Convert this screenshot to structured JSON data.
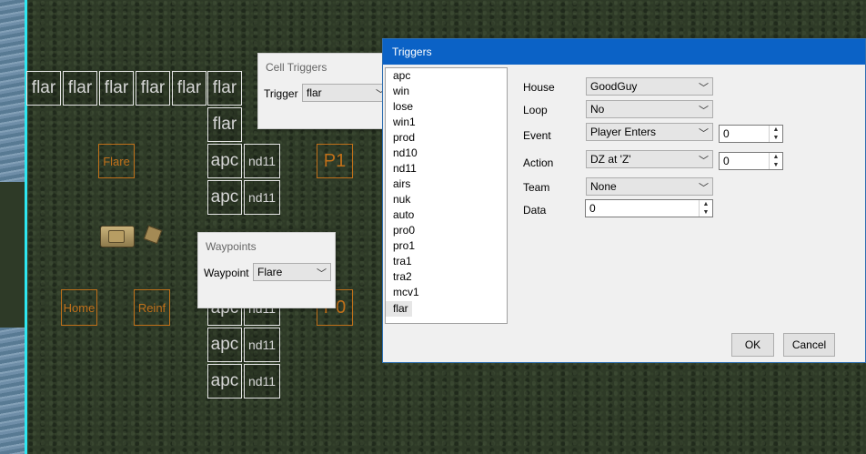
{
  "map": {
    "trigger_cells_top": [
      "flar",
      "flar",
      "flar",
      "flar",
      "flar",
      "flar"
    ],
    "trigger_cell_flar2": "flar",
    "apc_rows": [
      {
        "left": "apc",
        "right": "nd11"
      },
      {
        "left": "apc",
        "right": "nd11"
      },
      {
        "left": "apc",
        "right": "nd11"
      },
      {
        "left": "apc",
        "right": "nd11"
      },
      {
        "left": "apc",
        "right": "nd11"
      }
    ],
    "waypoints": {
      "flare": "Flare",
      "p1": "P1",
      "home": "Home",
      "reinf": "Reinf",
      "p0": "P0"
    }
  },
  "cell_triggers": {
    "title": "Cell Triggers",
    "trigger_label": "Trigger",
    "trigger_value": "flar"
  },
  "waypoints_panel": {
    "title": "Waypoints",
    "waypoint_label": "Waypoint",
    "waypoint_value": "Flare"
  },
  "triggers_dialog": {
    "title": "Triggers",
    "list": [
      "apc",
      "win",
      "lose",
      "win1",
      "prod",
      "nd10",
      "nd11",
      "airs",
      "nuk",
      "auto",
      "pro0",
      "pro1",
      "tra1",
      "tra2",
      "mcv1",
      "flar"
    ],
    "selected": "flar",
    "fields": {
      "house_label": "House",
      "house_value": "GoodGuy",
      "loop_label": "Loop",
      "loop_value": "No",
      "event_label": "Event",
      "event_value": "Player Enters",
      "event_param": "0",
      "action_label": "Action",
      "action_value": "DZ at 'Z'",
      "action_param": "0",
      "team_label": "Team",
      "team_value": "None",
      "data_label": "Data",
      "data_value": "0"
    },
    "ok_label": "OK",
    "cancel_label": "Cancel"
  }
}
